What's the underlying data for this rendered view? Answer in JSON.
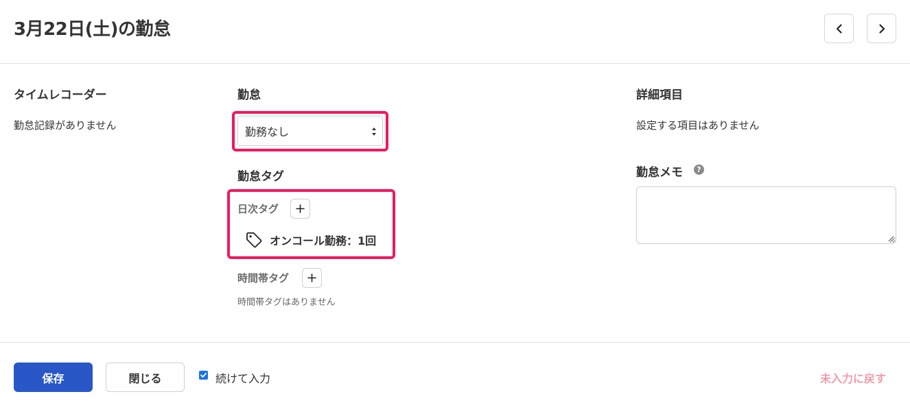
{
  "header": {
    "title": "3月22日(土)の勤怠"
  },
  "time_recorder": {
    "title": "タイムレコーダー",
    "empty_text": "勤怠記録がありません"
  },
  "attendance": {
    "title": "勤怠",
    "select_value": "勤務なし"
  },
  "attendance_tags": {
    "title": "勤怠タグ",
    "daily_tags_label": "日次タグ",
    "daily_tags": [
      {
        "label": "オンコール勤務：1回"
      }
    ],
    "time_tags_label": "時間帯タグ",
    "time_tags_empty": "時間帯タグはありません"
  },
  "details": {
    "title": "詳細項目",
    "empty_text": "設定する項目はありません"
  },
  "memo": {
    "title": "勤怠メモ",
    "help_glyph": "?",
    "value": ""
  },
  "footer": {
    "save_label": "保存",
    "close_label": "閉じる",
    "continue_label": "続けて入力",
    "continue_checked": true,
    "reset_label": "未入力に戻す"
  },
  "colors": {
    "primary": "#2957c8",
    "highlight": "#f0185f",
    "reset_link": "#f39ba8"
  },
  "icons": {
    "prev": "chevron-left-icon",
    "next": "chevron-right-icon",
    "add": "plus-icon",
    "tag": "tag-icon",
    "help": "question-circle-icon",
    "check": "checkmark-icon"
  }
}
